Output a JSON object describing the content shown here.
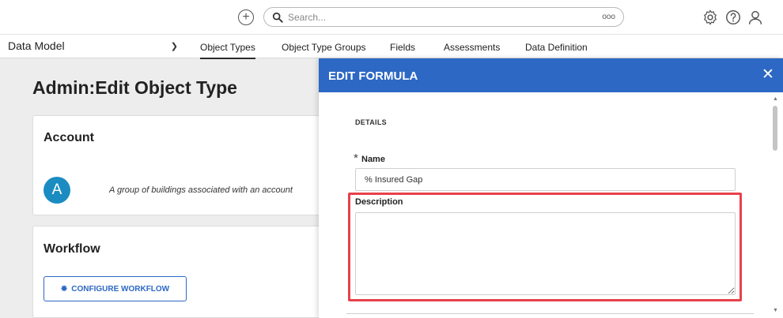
{
  "topbar": {
    "add_icon": "plus-circle-icon",
    "search_placeholder": "Search...",
    "search_more": "ooo",
    "icons": [
      "gear-icon",
      "help-icon",
      "user-icon"
    ]
  },
  "nav": {
    "model_select": "Data Model",
    "tabs": [
      {
        "label": "Object Types",
        "active": true
      },
      {
        "label": "Object Type Groups",
        "active": false
      },
      {
        "label": "Fields",
        "active": false
      },
      {
        "label": "Assessments",
        "active": false
      },
      {
        "label": "Data Definition",
        "active": false
      }
    ]
  },
  "page": {
    "title": "Admin:Edit Object Type"
  },
  "account_card": {
    "title": "Account",
    "avatar_letter": "A",
    "description": "A group of buildings associated with an account"
  },
  "workflow_card": {
    "title": "Workflow",
    "button_label": "CONFIGURE WORKFLOW"
  },
  "modal": {
    "title": "EDIT FORMULA",
    "close_icon": "close-icon",
    "section_label": "DETAILS",
    "name_required_mark": "*",
    "name_label": "Name",
    "name_value": "% Insured Gap",
    "description_label": "Description",
    "description_value": ""
  },
  "colors": {
    "brand_blue": "#2d68c4",
    "avatar_blue": "#1b8cc2",
    "highlight_red": "#e8414a"
  }
}
